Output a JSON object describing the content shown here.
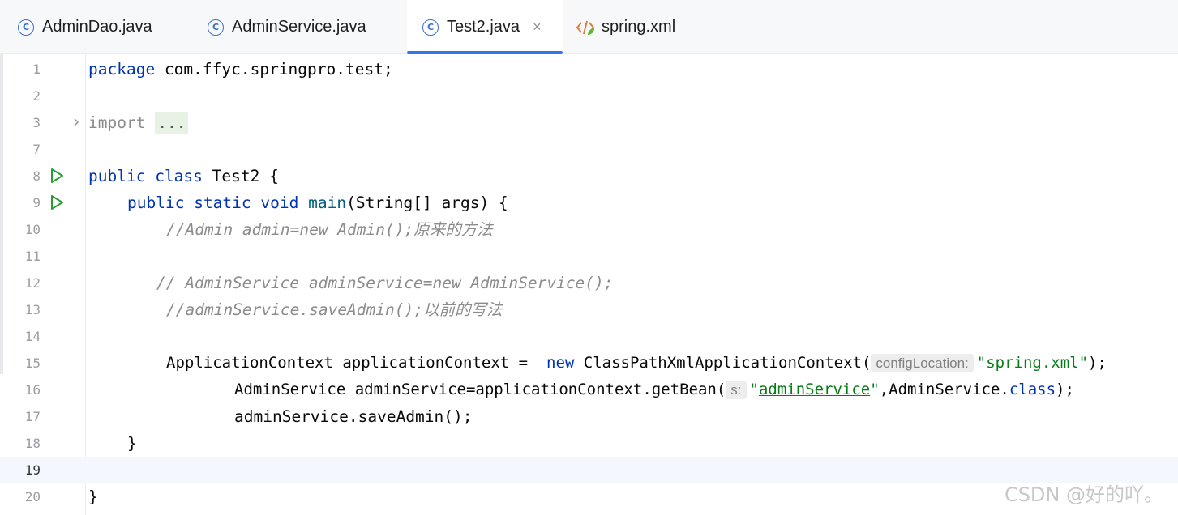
{
  "tabs": [
    {
      "label": "AdminDao.java",
      "icon": "class-icon"
    },
    {
      "label": "AdminService.java",
      "icon": "class-icon"
    },
    {
      "label": "Test2.java",
      "icon": "class-icon",
      "active": true,
      "close": "×"
    },
    {
      "label": "spring.xml",
      "icon": "xml-file-icon"
    }
  ],
  "colors": {
    "accent": "#3574f0",
    "keyword": "#0033b3",
    "string": "#067d17",
    "comment": "#8c8c8c",
    "method": "#00627a",
    "run": "#2a9d36"
  },
  "lines": [
    {
      "n": "1",
      "t1": "package",
      "t2": " com.ffyc.springpro.test;"
    },
    {
      "n": "2"
    },
    {
      "n": "3",
      "t1": "import",
      "t2": "..."
    },
    {
      "n": "7"
    },
    {
      "n": "8",
      "t1": "public",
      "t2": "class",
      "t3": " Test2 {"
    },
    {
      "n": "9",
      "t1": "public",
      "t2": "static",
      "t3": "void",
      "t4": "main",
      "t5": "(String[] args) {"
    },
    {
      "n": "10",
      "t1": "//Admin admin=new Admin();原来的方法"
    },
    {
      "n": "11"
    },
    {
      "n": "12",
      "t1": "// AdminService adminService=new AdminService();"
    },
    {
      "n": "13",
      "t1": "//adminService.saveAdmin();以前的写法"
    },
    {
      "n": "14"
    },
    {
      "n": "15",
      "t1": "ApplicationContext applicationContext = ",
      "t2": "new",
      "t3": " ClassPathXmlApplicationContext(",
      "t4": "configLocation:",
      "t5": "\"spring.xml\"",
      "t6": ");"
    },
    {
      "n": "16",
      "t1": "AdminService adminService=applicationContext.getBean(",
      "t2": "s:",
      "t3": "\"",
      "t4": "adminService",
      "t5": "\"",
      "t6": ",AdminService.",
      "t7": "class",
      "t8": ");"
    },
    {
      "n": "17",
      "t1": "adminService.saveAdmin();"
    },
    {
      "n": "18",
      "t1": "}"
    },
    {
      "n": "19"
    },
    {
      "n": "20",
      "t1": "}"
    }
  ],
  "watermark": "CSDN @好的吖。"
}
